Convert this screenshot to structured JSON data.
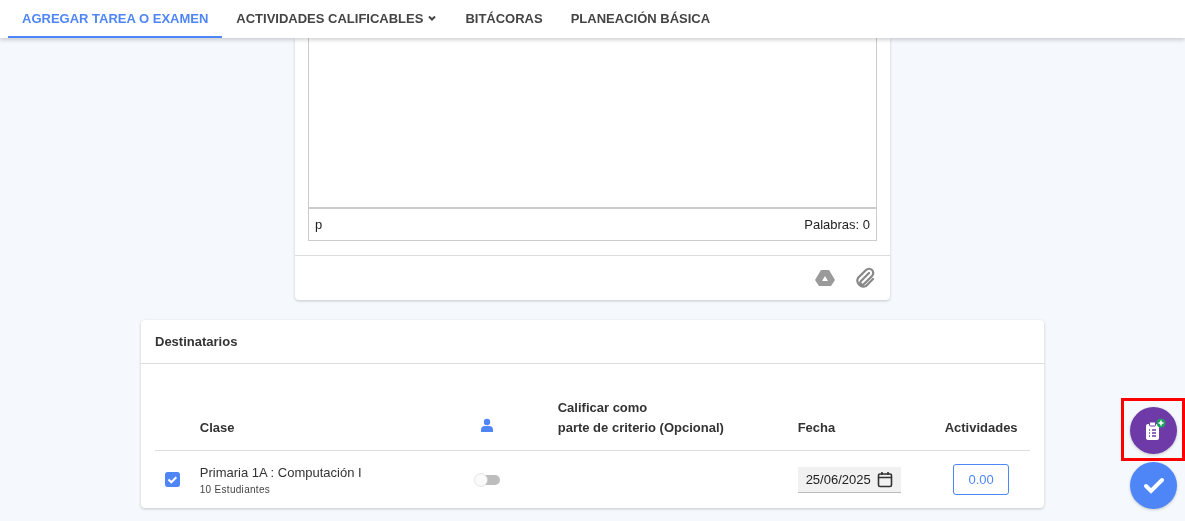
{
  "tabs": [
    {
      "label": "AGREGAR TAREA O EXAMEN",
      "selected": true,
      "has_menu": false
    },
    {
      "label": "ACTIVIDADES CALIFICABLES",
      "selected": false,
      "has_menu": true
    },
    {
      "label": "BITÁCORAS",
      "selected": false,
      "has_menu": false
    },
    {
      "label": "PLANEACIÓN BÁSICA",
      "selected": false,
      "has_menu": false
    }
  ],
  "editor": {
    "path": "p",
    "word_count": "Palabras: 0"
  },
  "recipients": {
    "title": "Destinatarios",
    "columns": [
      {
        "kind": "blank"
      },
      {
        "kind": "text",
        "label": "Clase"
      },
      {
        "kind": "icon"
      },
      {
        "kind": "text",
        "label": "Calificar como\nparte de criterio (Opcional)"
      },
      {
        "kind": "text",
        "label": "Fecha"
      },
      {
        "kind": "text",
        "label": "Actividades"
      }
    ],
    "rows": [
      {
        "checked": true,
        "class": "Primaria 1A : Computación I",
        "students": "10 Estudiantes",
        "grade_on": false,
        "date": "25/06/2025",
        "activities": "0.00"
      }
    ]
  },
  "fabs": [
    {
      "kind": "add-task",
      "highlighted": true
    },
    {
      "kind": "confirm",
      "highlighted": false
    }
  ]
}
